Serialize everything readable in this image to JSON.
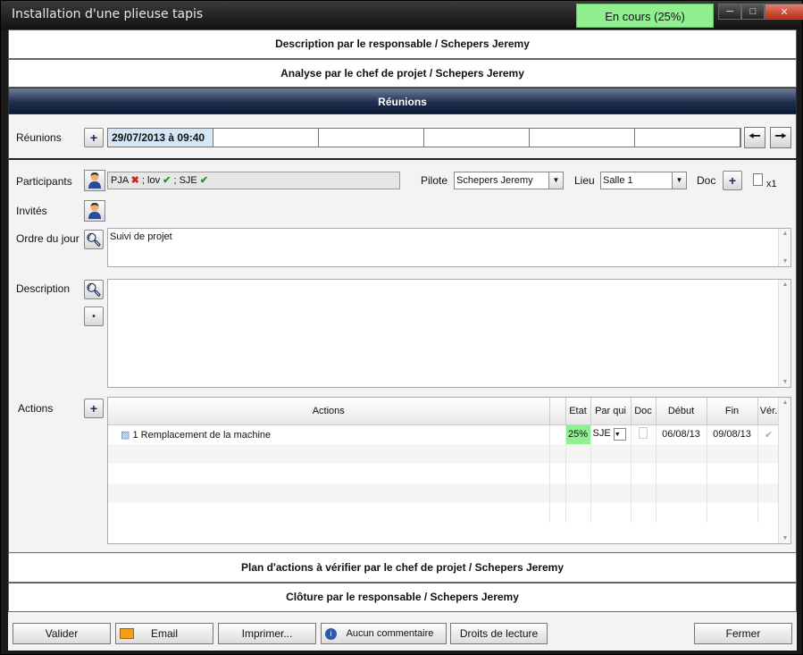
{
  "window": {
    "title": "Installation d'une plieuse tapis",
    "status": "En cours (25%)",
    "status_color": "#90f090"
  },
  "sections": {
    "description": "Description par le responsable / Schepers Jeremy",
    "analyse": "Analyse par le chef de projet / Schepers Jeremy",
    "reunions": "Réunions",
    "plan": "Plan d'actions à vérifier par le chef de projet / Schepers Jeremy",
    "cloture": "Clôture par le responsable / Schepers Jeremy"
  },
  "reunions": {
    "label": "Réunions",
    "dates": [
      "29/07/2013 à 09:40",
      "",
      "",
      "",
      "",
      ""
    ]
  },
  "participants": {
    "label": "Participants",
    "entries": [
      {
        "code": "PJA",
        "status": "absent"
      },
      {
        "code": "lov",
        "status": "present"
      },
      {
        "code": "SJE",
        "status": "present"
      }
    ],
    "separator": ";"
  },
  "pilote": {
    "label": "Pilote",
    "value": "Schepers Jeremy"
  },
  "lieu": {
    "label": "Lieu",
    "value": "Salle 1"
  },
  "doc": {
    "label": "Doc",
    "count": "x1"
  },
  "invites": {
    "label": "Invités"
  },
  "ordre": {
    "label": "Ordre du jour",
    "value": "Suivi de projet"
  },
  "description": {
    "label": "Description",
    "value": ""
  },
  "actions": {
    "label": "Actions",
    "columns": [
      "Actions",
      "Etat",
      "Par qui",
      "Doc",
      "Début",
      "Fin",
      "Vér."
    ],
    "rows": [
      {
        "title": "1 Remplacement de la machine",
        "etat": "25%",
        "par_qui": "SJE",
        "debut": "06/08/13",
        "fin": "09/08/13"
      }
    ]
  },
  "buttons": {
    "valider": "Valider",
    "email": "Email",
    "imprimer": "Imprimer...",
    "commentaire": "Aucun commentaire",
    "droits": "Droits de lecture",
    "fermer": "Fermer"
  }
}
